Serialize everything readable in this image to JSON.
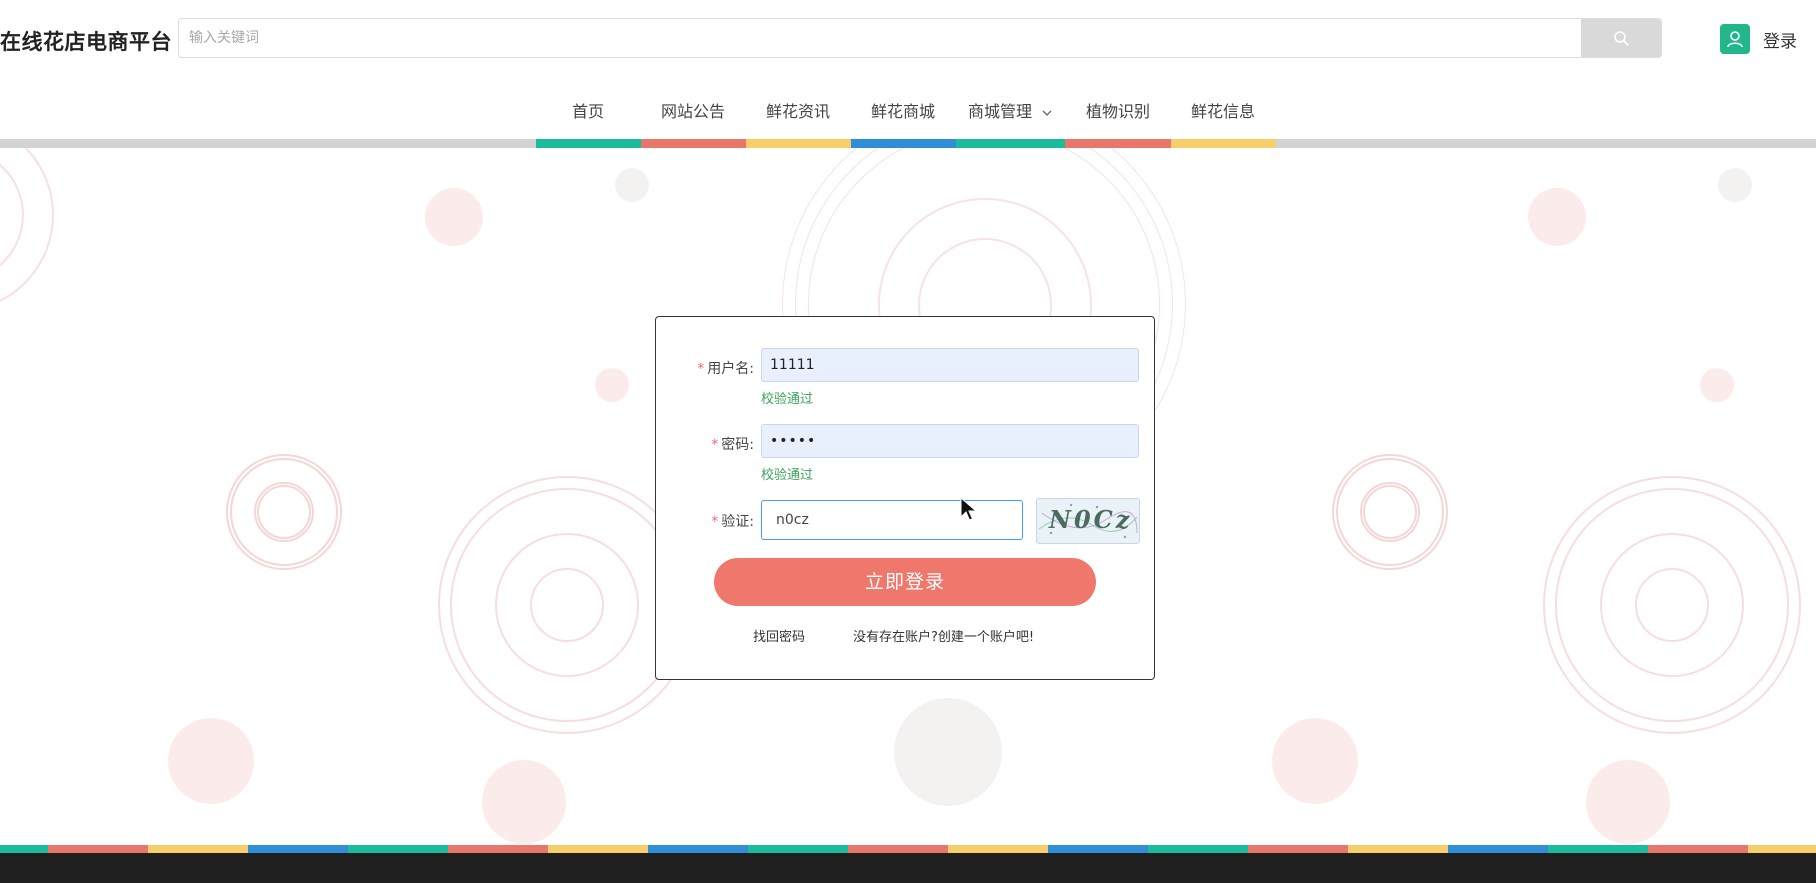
{
  "header": {
    "brand": "在线花店电商平台",
    "search_placeholder": "输入关键词",
    "login_label": "登录"
  },
  "nav": {
    "items": [
      {
        "label": "首页"
      },
      {
        "label": "网站公告"
      },
      {
        "label": "鲜花资讯"
      },
      {
        "label": "鲜花商城"
      },
      {
        "label": "商城管理"
      },
      {
        "label": "植物识别"
      },
      {
        "label": "鲜花信息"
      }
    ]
  },
  "colors": {
    "teal": "#1abc9c",
    "red": "#e8766b",
    "yellow": "#f7cf6a",
    "blue": "#2e8fd8",
    "button": "#f0776b",
    "valid": "#3aa55a",
    "footer": "#1f1f1f"
  },
  "login_form": {
    "username": {
      "label": "用户名:",
      "value": "11111",
      "validation": "校验通过"
    },
    "password": {
      "label": "密码:",
      "value": "•••••",
      "validation": "校验通过"
    },
    "captcha": {
      "label": "验证:",
      "value": "n0cz",
      "image_text": "N0Cz"
    },
    "submit_label": "立即登录",
    "forgot_password": "找回密码",
    "register": "没有存在账户?创建一个账户吧!"
  }
}
